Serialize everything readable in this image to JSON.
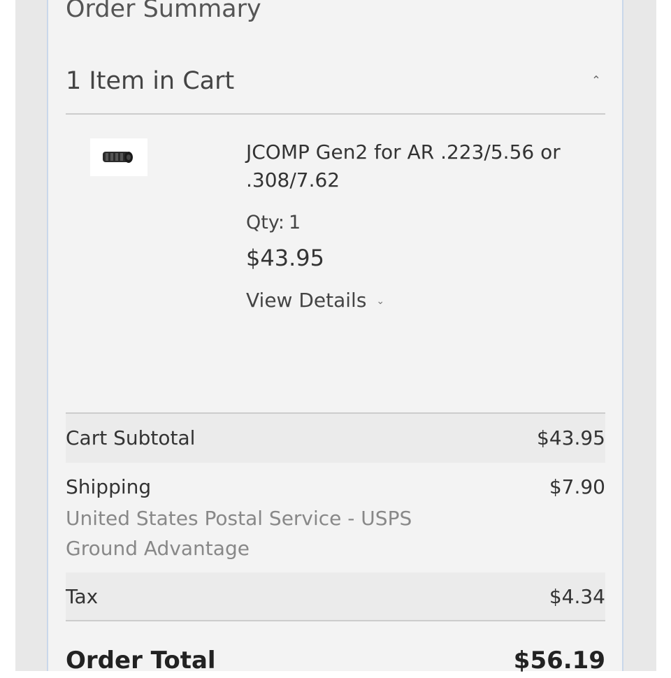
{
  "summary": {
    "title": "Order Summary",
    "items_heading": "1 Item in Cart",
    "collapse_icon": "chevron-up-icon"
  },
  "item": {
    "name": "JCOMP Gen2 for AR .223/5.56 or .308/7.62",
    "qty_label": "Qty:",
    "qty": "1",
    "price": "$43.95",
    "details_label": "View Details",
    "details_icon": "chevron-down-icon"
  },
  "totals": {
    "subtotal_label": "Cart Subtotal",
    "subtotal": "$43.95",
    "shipping_label": "Shipping",
    "shipping": "$7.90",
    "shipping_method": "United States Postal Service - USPS Ground Advantage",
    "tax_label": "Tax",
    "tax": "$4.34",
    "order_total_label": "Order Total",
    "order_total": "$56.19"
  },
  "colors": {
    "panel_bg": "#f3f3f3",
    "panel_border": "#c9d7ea",
    "row_alt_bg": "#ebebeb",
    "muted_text": "#888888"
  }
}
